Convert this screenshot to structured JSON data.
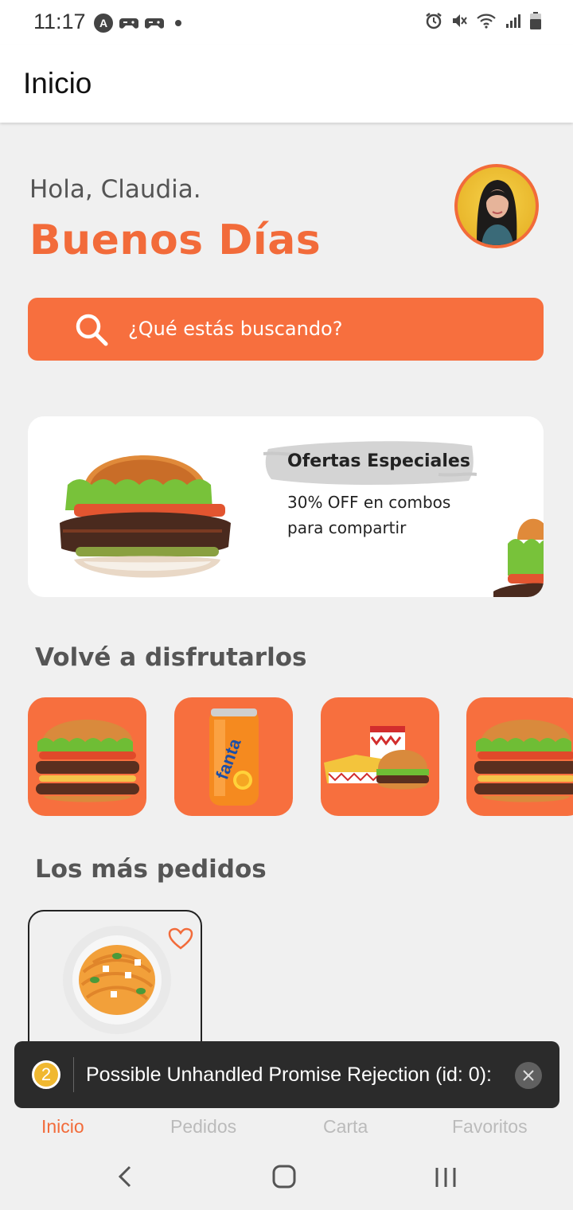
{
  "status_bar": {
    "time": "11:17",
    "left_icons": [
      "a-icon",
      "gamepad-icon",
      "gamepad-icon",
      "dot-icon"
    ],
    "right_icons": [
      "alarm-icon",
      "mute-icon",
      "wifi-icon",
      "signal-icon",
      "battery-icon"
    ]
  },
  "app_bar": {
    "title": "Inicio"
  },
  "greeting": {
    "hello": "Hola, Claudia.",
    "headline": "Buenos Días"
  },
  "search": {
    "placeholder": "¿Qué estás buscando?"
  },
  "promo": {
    "title": "Ofertas Especiales",
    "line1": "30% OFF en combos",
    "line2": "para compartir"
  },
  "reorder": {
    "title": "Volvé a disfrutarlos",
    "items": [
      "burger",
      "fanta",
      "combo",
      "burger"
    ]
  },
  "most_ordered": {
    "title": "Los más pedidos",
    "items": [
      "spaghetti"
    ]
  },
  "bottom_nav": {
    "items": [
      {
        "label": "Inicio",
        "active": true
      },
      {
        "label": "Pedidos",
        "active": false
      },
      {
        "label": "Carta",
        "active": false
      },
      {
        "label": "Favoritos",
        "active": false
      }
    ]
  },
  "toast": {
    "count": "2",
    "message": "Possible Unhandled Promise Rejection (id: 0):"
  },
  "colors": {
    "accent": "#f76f3e",
    "headline": "#f26b3a",
    "toast_bg": "#2b2b2b"
  }
}
